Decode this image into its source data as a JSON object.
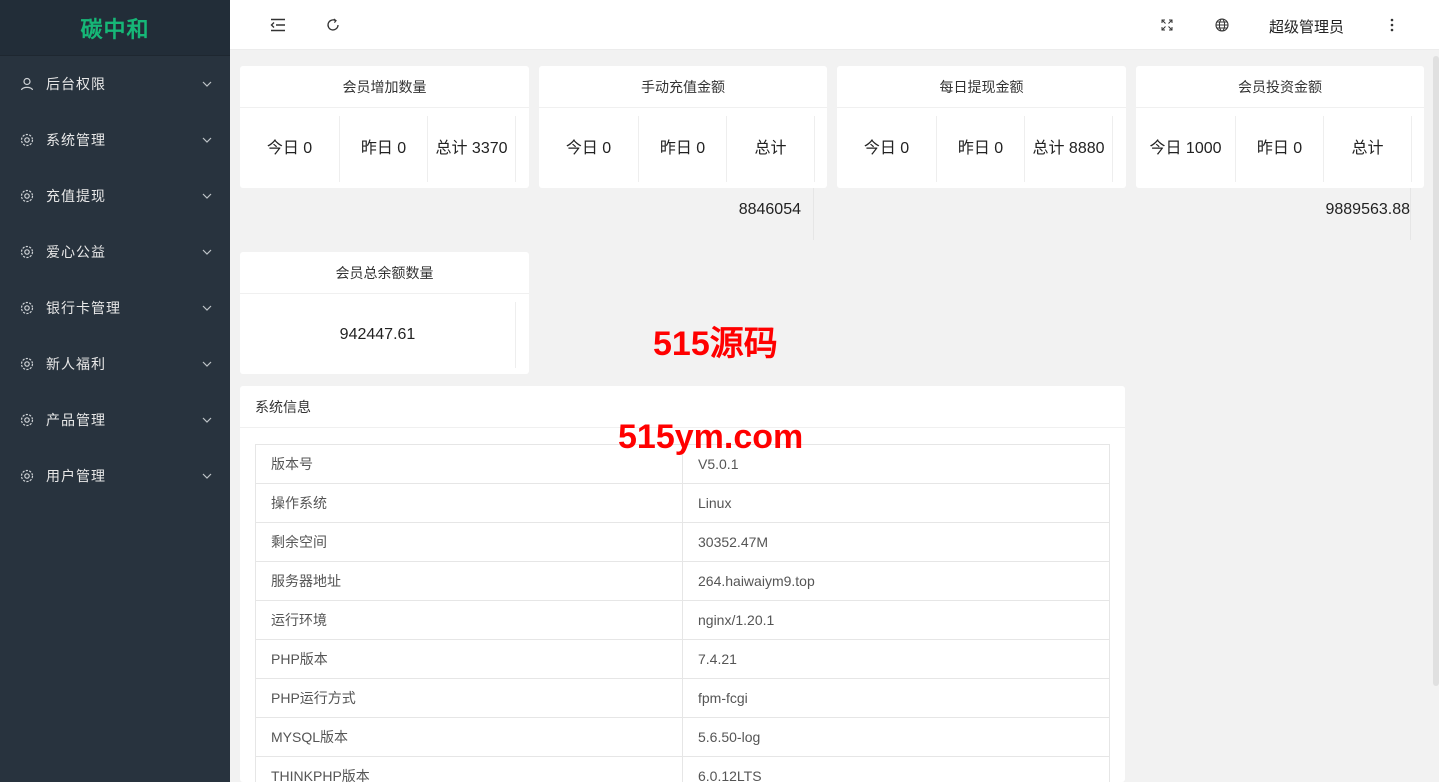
{
  "brand": "碳中和",
  "sidebar": {
    "items": [
      {
        "label": "后台权限",
        "icon": "user-icon"
      },
      {
        "label": "系统管理",
        "icon": "gear-icon"
      },
      {
        "label": "充值提现",
        "icon": "gear-icon"
      },
      {
        "label": "爱心公益",
        "icon": "gear-icon"
      },
      {
        "label": "银行卡管理",
        "icon": "gear-icon"
      },
      {
        "label": "新人福利",
        "icon": "gear-icon"
      },
      {
        "label": "产品管理",
        "icon": "gear-icon"
      },
      {
        "label": "用户管理",
        "icon": "gear-icon"
      }
    ]
  },
  "header": {
    "user": "超级管理员",
    "icons": [
      "menu-fold-icon",
      "refresh-icon",
      "fullscreen-icon",
      "globe-icon",
      "more-vertical-icon"
    ]
  },
  "stats": [
    {
      "title": "会员增加数量",
      "today": "今日 0",
      "yesterday": "昨日 0",
      "total": "总计 3370",
      "overflow": ""
    },
    {
      "title": "手动充值金额",
      "today": "今日 0",
      "yesterday": "昨日 0",
      "total": "总计",
      "overflow": "8846054"
    },
    {
      "title": "每日提现金额",
      "today": "今日 0",
      "yesterday": "昨日 0",
      "total": "总计 8880",
      "overflow": ""
    },
    {
      "title": "会员投资金额",
      "today": "今日 1000",
      "yesterday": "昨日 0",
      "total": "总计",
      "overflow": "9889563.88"
    }
  ],
  "balance": {
    "title": "会员总余额数量",
    "value": "942447.61"
  },
  "system_info": {
    "title": "系统信息",
    "rows": [
      {
        "key": "版本号",
        "value": "V5.0.1"
      },
      {
        "key": "操作系统",
        "value": "Linux"
      },
      {
        "key": "剩余空间",
        "value": "30352.47M"
      },
      {
        "key": "服务器地址",
        "value": "264.haiwaiym9.top"
      },
      {
        "key": "运行环境",
        "value": "nginx/1.20.1"
      },
      {
        "key": "PHP版本",
        "value": "7.4.21"
      },
      {
        "key": "PHP运行方式",
        "value": "fpm-fcgi"
      },
      {
        "key": "MYSQL版本",
        "value": "5.6.50-log"
      },
      {
        "key": "THINKPHP版本",
        "value": "6.0.12LTS"
      }
    ]
  },
  "watermarks": {
    "line1": "515源码",
    "line2": "515ym.com"
  },
  "colors": {
    "sidebar_bg": "#28333e",
    "brand": "#16b777",
    "watermark": "#ff0000"
  }
}
